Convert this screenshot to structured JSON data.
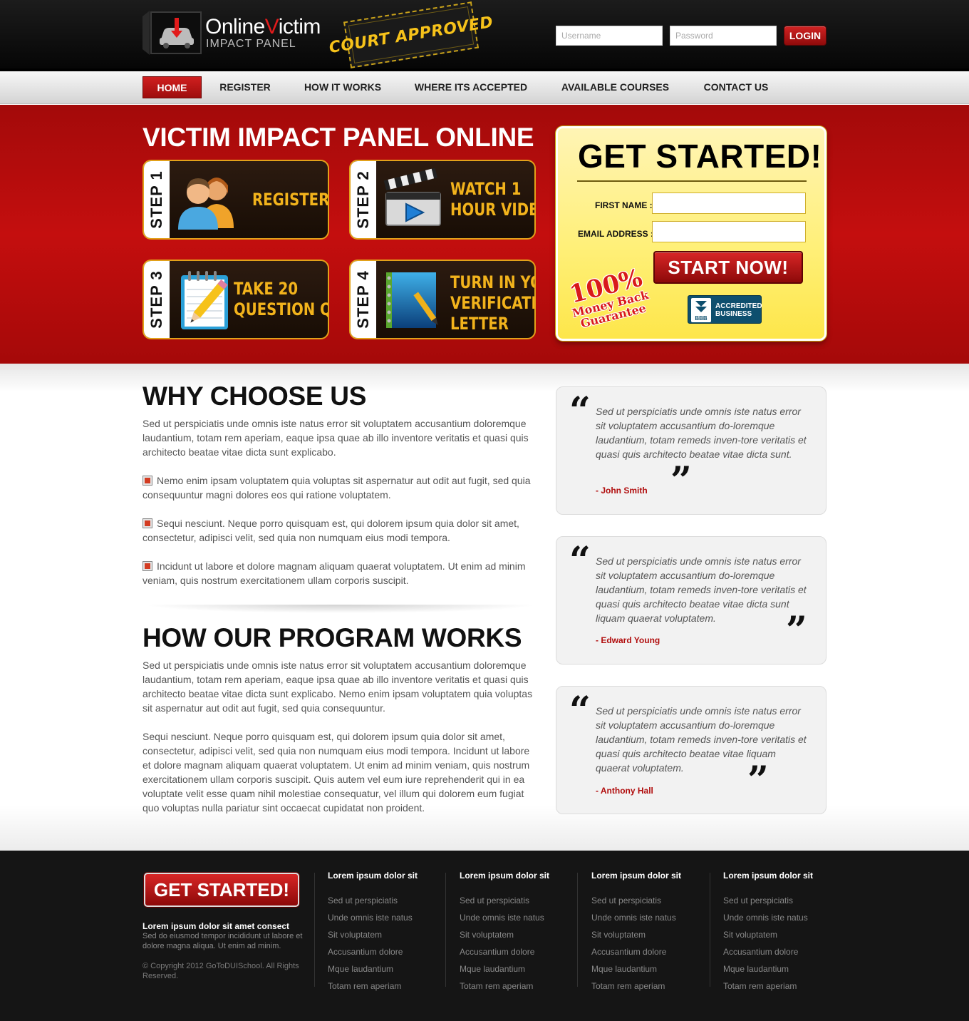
{
  "header": {
    "logo": {
      "name_part1": "Online",
      "name_accent": "V",
      "name_part2": "ictim",
      "subtitle": "IMPACT PANEL"
    },
    "stamp_text": "COURT APPROVED",
    "login": {
      "username_placeholder": "Username",
      "password_placeholder": "Password",
      "button_label": "LOGIN"
    }
  },
  "nav": {
    "items": [
      {
        "label": "HOME",
        "active": true
      },
      {
        "label": "REGISTER"
      },
      {
        "label": "HOW IT WORKS"
      },
      {
        "label": "WHERE ITS ACCEPTED"
      },
      {
        "label": "AVAILABLE COURSES"
      },
      {
        "label": "CONTACT US"
      }
    ]
  },
  "hero": {
    "title": "VICTIM IMPACT PANEL ONLINE",
    "steps": [
      {
        "tab": "STEP 1",
        "lines": [
          "REGISTER"
        ],
        "icon": "users-icon"
      },
      {
        "tab": "STEP 2",
        "lines": [
          "WATCH 1",
          "HOUR VIDEO"
        ],
        "icon": "clapperboard-icon"
      },
      {
        "tab": "STEP 3",
        "lines": [
          "TAKE 20",
          "QUESTION QUIZ"
        ],
        "icon": "notepad-pencil-icon"
      },
      {
        "tab": "STEP 4",
        "lines": [
          "TURN IN YOUR",
          "VERIFICATION",
          "LETTER"
        ],
        "icon": "notebook-pen-icon"
      }
    ],
    "signup": {
      "title": "GET STARTED!",
      "first_name_label": "FIRST NAME :",
      "email_label": "EMAIL ADDRESS :",
      "first_name_value": "",
      "email_value": "",
      "button_label": "START NOW!",
      "guarantee": {
        "pct": "100%",
        "line1": "Money Back",
        "line2": "Guarantee"
      },
      "bbb": {
        "line1": "ACCREDITED",
        "line2": "BUSINESS",
        "mark": "BBB"
      }
    }
  },
  "why": {
    "title": "WHY CHOOSE US",
    "intro": "Sed ut perspiciatis unde omnis iste natus error sit voluptatem accusantium doloremque laudantium, totam rem aperiam, eaque ipsa quae ab illo inventore veritatis et quasi quis architecto beatae vitae dicta sunt explicabo.",
    "points": [
      "Nemo enim ipsam voluptatem quia voluptas sit aspernatur aut odit aut fugit, sed quia consequuntur magni dolores eos qui ratione voluptatem.",
      "Sequi nesciunt. Neque porro quisquam est, qui dolorem ipsum quia dolor sit amet, consectetur, adipisci velit, sed quia non numquam eius modi tempora.",
      "Incidunt ut labore et dolore magnam aliquam quaerat voluptatem. Ut enim ad minim veniam, quis nostrum exercitationem ullam corporis suscipit."
    ]
  },
  "program": {
    "title": "HOW OUR PROGRAM WORKS",
    "para1": "Sed ut perspiciatis unde omnis iste natus error sit voluptatem accusantium doloremque laudantium, totam rem aperiam, eaque ipsa quae ab illo inventore veritatis et quasi quis architecto beatae vitae dicta sunt explicabo. Nemo enim ipsam voluptatem quia voluptas sit aspernatur aut odit aut fugit, sed quia consequuntur.",
    "para2": "Sequi nesciunt. Neque porro quisquam est, qui dolorem ipsum quia dolor sit amet, consectetur, adipisci velit, sed quia non numquam eius modi tempora. Incidunt ut labore et dolore magnam aliquam quaerat voluptatem. Ut enim ad minim veniam, quis nostrum exercitationem ullam corporis suscipit. Quis autem vel eum iure reprehenderit qui in ea voluptate velit esse quam nihil molestiae consequatur, vel illum qui dolorem eum fugiat quo voluptas nulla pariatur sint occaecat cupidatat non proident."
  },
  "testimonials": [
    {
      "text": "Sed ut perspiciatis unde omnis iste natus error sit voluptatem accusantium do-loremque laudantium, totam remeds inven-tore veritatis et quasi quis architecto beatae vitae dicta sunt.",
      "author": "- John Smith"
    },
    {
      "text": "Sed ut perspiciatis unde omnis iste natus error sit voluptatem accusantium do-loremque laudantium, totam remeds inven-tore veritatis et quasi quis architecto beatae vitae dicta sunt liquam quaerat voluptatem.",
      "author": "- Edward Young"
    },
    {
      "text": "Sed ut perspiciatis unde omnis iste natus error sit voluptatem accusantium do-loremque laudantium, totam remeds inven-tore veritatis et quasi quis architecto beatae vitae liquam quaerat voluptatem.",
      "author": "- Anthony Hall"
    }
  ],
  "footer": {
    "button_label": "GET STARTED!",
    "tagline": "Lorem ipsum dolor sit amet consect",
    "description": "Sed do eiusmod tempor incididunt ut labore et dolore magna aliqua. Ut enim ad minim.",
    "copyright": "© Copyright 2012 GoToDUISchool. All Rights Reserved.",
    "columns": [
      {
        "title": "Lorem ipsum dolor sit",
        "links": [
          "Sed ut perspiciatis",
          "Unde omnis iste natus",
          "Sit voluptatem",
          "Accusantium dolore",
          "Mque laudantium",
          "Totam rem aperiam"
        ]
      },
      {
        "title": "Lorem ipsum dolor sit",
        "links": [
          "Sed ut perspiciatis",
          "Unde omnis iste natus",
          "Sit voluptatem",
          "Accusantium dolore",
          "Mque laudantium",
          "Totam rem aperiam"
        ]
      },
      {
        "title": "Lorem ipsum dolor sit",
        "links": [
          "Sed ut perspiciatis",
          "Unde omnis iste natus",
          "Sit voluptatem",
          "Accusantium dolore",
          "Mque laudantium",
          "Totam rem aperiam"
        ]
      },
      {
        "title": "Lorem ipsum dolor sit",
        "links": [
          "Sed ut perspiciatis",
          "Unde omnis iste natus",
          "Sit voluptatem",
          "Accusantium dolore",
          "Mque laudantium",
          "Totam rem aperiam"
        ]
      }
    ]
  },
  "colors": {
    "brand_red": "#c40e0e",
    "accent_gold": "#f2b31c",
    "panel_yellow": "#fff07a",
    "footer_bg": "#151515"
  }
}
